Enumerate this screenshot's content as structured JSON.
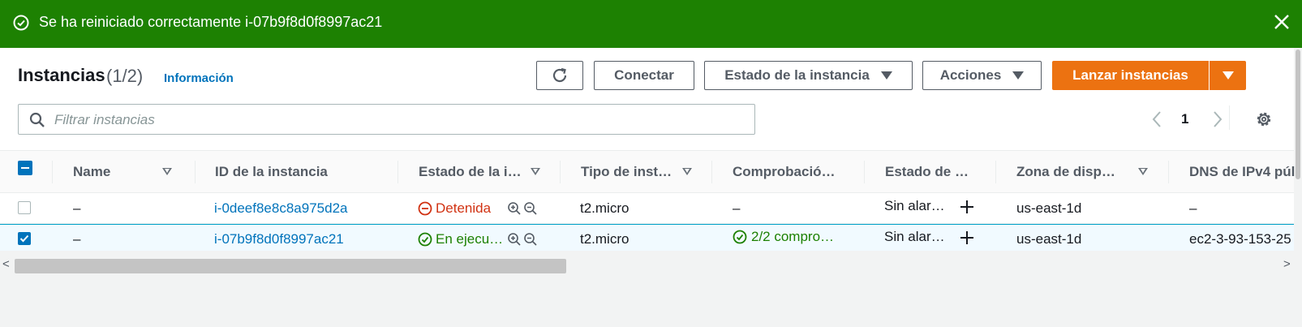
{
  "flash": {
    "message": "Se ha reiniciado correctamente i-07b9f8d0f8997ac21",
    "icon": "check-circle-icon",
    "close_icon": "close-icon",
    "color": "#1d8102"
  },
  "header": {
    "title": "Instancias",
    "count": "(1/2)",
    "info_link": "Información"
  },
  "buttons": {
    "refresh_icon": "refresh-icon",
    "connect": "Conectar",
    "instance_state": "Estado de la instancia",
    "actions": "Acciones",
    "launch": "Lanzar instancias",
    "launch_color": "#ec7211"
  },
  "search": {
    "placeholder": "Filtrar instancias"
  },
  "pagination": {
    "page": "1"
  },
  "table": {
    "columns": [
      "Name",
      "ID de la instancia",
      "Estado de la i…",
      "Tipo de inst…",
      "Comprobació…",
      "Estado de …",
      "Zona de dispo…",
      "DNS de IPv4 púl"
    ],
    "rows": [
      {
        "selected": false,
        "name": "–",
        "id": "i-0deef8e8c8a975d2a",
        "state": "Detenida",
        "type": "t2.micro",
        "checks": "–",
        "alarm": "Sin alar…",
        "zone": "us-east-1d",
        "dns": "–"
      },
      {
        "selected": true,
        "name": "–",
        "id": "i-07b9f8d0f8997ac21",
        "state": "En ejecu…",
        "type": "t2.micro",
        "checks": "2/2 compro…",
        "alarm": "Sin alar…",
        "zone": "us-east-1d",
        "dns": "ec2-3-93-153-25"
      }
    ]
  }
}
